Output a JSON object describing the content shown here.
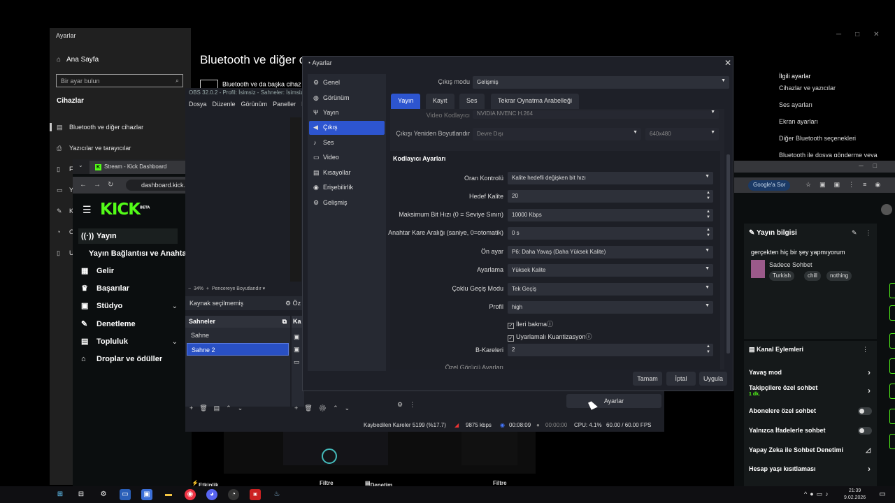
{
  "windows_settings": {
    "title": "Ayarlar",
    "home": "Ana Sayfa",
    "search_placeholder": "Bir ayar bulun",
    "section": "Cihazlar",
    "items": [
      "Bluetooth ve diğer cihazlar",
      "Yazıcılar ve tarayıcılar",
      "F",
      "Y",
      "K",
      "O",
      "U"
    ]
  },
  "bt_page": {
    "title": "Bluetooth ve diğer c",
    "subtitle": "Bluetooth ve da başka cihaz e"
  },
  "related": {
    "title": "İlgili ayarlar",
    "links": [
      "Cihazlar ve yazıcılar",
      "Ses ayarları",
      "Ekran ayarları",
      "Diğer Bluetooth seçenekleri",
      "Bluetooth ile dosya gönderme veya"
    ]
  },
  "chrome_left": {
    "tab_title": "Stream - Kick Dashboard",
    "url": "dashboard.kick.c",
    "logo": "KICK",
    "logo_badge": "BETA",
    "nav": [
      {
        "label": "Yayın",
        "icon": "broadcast-icon"
      },
      {
        "label": "Yayın Bağlantısı ve Anahtarı",
        "icon": ""
      },
      {
        "label": "Gelir",
        "icon": "money-icon"
      },
      {
        "label": "Başarılar",
        "icon": "trophy-icon"
      },
      {
        "label": "Stüdyo",
        "icon": "studio-icon"
      },
      {
        "label": "Denetleme",
        "icon": "wrench-icon"
      },
      {
        "label": "Topluluk",
        "icon": "community-icon"
      },
      {
        "label": "Droplar ve ödüller",
        "icon": "gift-icon"
      }
    ]
  },
  "obs": {
    "title": "OBS 32.0.2 - Profil: İsimsiz - Sahneler: İsimsiz",
    "menu": [
      "Dosya",
      "Düzenle",
      "Görünüm",
      "Paneller",
      "E"
    ],
    "zoom": "34%",
    "fit_label": "Pencereye Boyutlandır",
    "no_source": "Kaynak seçilmemiş",
    "props_label": "Öz",
    "scenes_header": "Sahneler",
    "sources_header": "Ka",
    "scenes": [
      "Sahne",
      "Sahne 2"
    ],
    "selected_scene": "Sahne 2",
    "settings_button": "Ayarlar",
    "status": {
      "dropped_frames": "Kaybedilen Kareler 5199 (%17.7)",
      "bitrate": "9875 kbps",
      "stream_time": "00:08:09",
      "rec_time": "00:00:00",
      "cpu": "CPU: 4.1%",
      "fps": "60.00 / 60.00 FPS"
    }
  },
  "settings_dialog": {
    "title": "Ayarlar",
    "sidebar": [
      "Genel",
      "Görünüm",
      "Yayın",
      "Çıkış",
      "Ses",
      "Video",
      "Kısayollar",
      "Erişebilirlik",
      "Gelişmiş"
    ],
    "selected": "Çıkış",
    "output_mode_label": "Çıkış modu",
    "output_mode": "Gelişmiş",
    "tabs": [
      "Yayın",
      "Kayıt",
      "Ses",
      "Tekrar Oynatma Arabelleği"
    ],
    "active_tab": "Yayın",
    "video_encoder_label": "Video Kodlayıcı",
    "video_encoder": "NVIDIA NVENC H.264",
    "rescale_label": "Çıkışı Yeniden Boyutlandır",
    "rescale": "Devre Dışı",
    "rescale_res": "640x480",
    "codec_section": "Kodlayıcı Ayarları",
    "fields": [
      {
        "label": "Oran Kontrolü",
        "value": "Kalite hedefli değişken bit hızı",
        "kind": "select"
      },
      {
        "label": "Hedef Kalite",
        "value": "20",
        "kind": "spin"
      },
      {
        "label": "Maksimum Bit Hızı (0 = Seviye Sınırı)",
        "value": "10000 Kbps",
        "kind": "spin"
      },
      {
        "label": "Anahtar Kare Aralığı (saniye, 0=otomatik)",
        "value": "0 s",
        "kind": "spin"
      },
      {
        "label": "Ön ayar",
        "value": "P6: Daha Yavaş (Daha Yüksek Kalite)",
        "kind": "select"
      },
      {
        "label": "Ayarlama",
        "value": "Yüksek Kalite",
        "kind": "select"
      },
      {
        "label": "Çoklu Geçiş Modu",
        "value": "Tek Geçiş",
        "kind": "select"
      },
      {
        "label": "Profil",
        "value": "high",
        "kind": "select"
      }
    ],
    "checkboxes": [
      {
        "label": "İleri bakma",
        "checked": true
      },
      {
        "label": "Uyarlamalı Kuantizasyon",
        "checked": true
      }
    ],
    "bframes_label": "B-Kareleri",
    "bframes": "2",
    "custom_label": "Özel Görücü Ayarları",
    "buttons": {
      "ok": "Tamam",
      "cancel": "İptal",
      "apply": "Uygula"
    }
  },
  "right_panel": {
    "search_chip": "Google'a Sor",
    "stream_info_title": "Yayın bilgisi",
    "stream_title": "gerçekten hiç bir şey yapmıyorum",
    "category": "Sadece Sohbet",
    "tags": [
      "Turkish",
      "chill",
      "nothing"
    ],
    "channel_actions_title": "Kanal Eylemleri",
    "actions": [
      {
        "label": "Yavaş mod",
        "kind": "arrow"
      },
      {
        "label": "Takipçilere özel sohbet",
        "sub": "1 dk.",
        "kind": "arrow"
      },
      {
        "label": "Abonelere özel sohbet",
        "kind": "toggle"
      },
      {
        "label": "Yalnızca İfadelerle sohbet",
        "kind": "toggle"
      },
      {
        "label": "Yapay Zeka ile Sohbet Denetimi",
        "kind": "glyph"
      },
      {
        "label": "Hesap yaşı kısıtlaması",
        "kind": "arrow"
      }
    ]
  },
  "bottom": {
    "activity": "Etkinlik Akışı",
    "filter1": "Filtre",
    "moderation": "Denetim Eylemleri",
    "filter2": "Filtre"
  },
  "taskbar": {
    "time": "21:39",
    "date": "9.02.2026"
  },
  "colors": {
    "kick_green": "#53fc18",
    "obs_accent": "#2d55cf"
  }
}
